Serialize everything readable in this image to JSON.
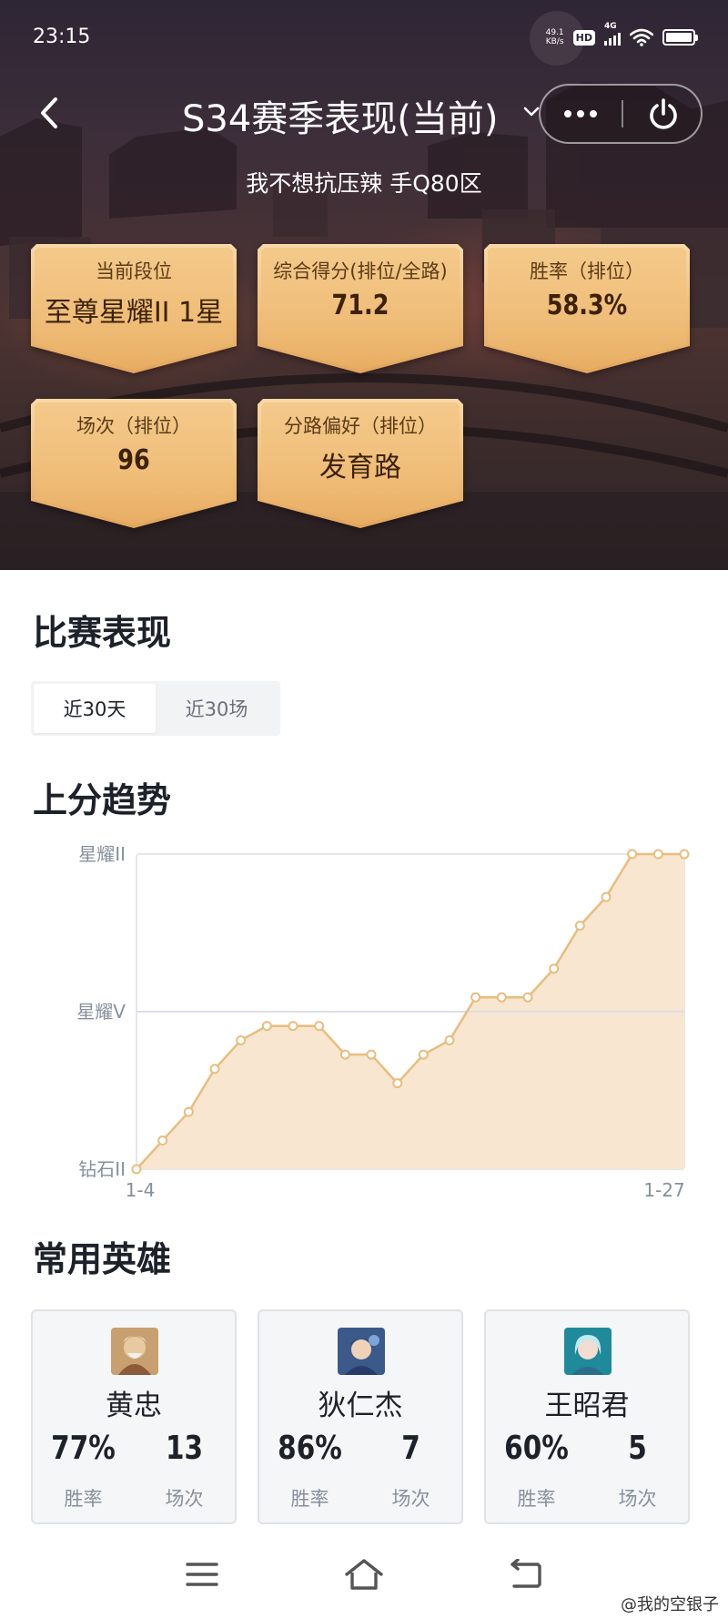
{
  "status_bar": {
    "time": "23:15",
    "net_speed_value": "49.1",
    "net_speed_unit": "KB/s",
    "hd": "HD",
    "network": "4G"
  },
  "header": {
    "title": "S34赛季表现(当前)",
    "player": "我不想抗压辣 手Q80区"
  },
  "stats": [
    {
      "label": "当前段位",
      "value": "至尊星耀II 1星"
    },
    {
      "label": "综合得分(排位/全路)",
      "value": "71.2"
    },
    {
      "label": "胜率（排位）",
      "value": "58.3%"
    },
    {
      "label": "场次（排位）",
      "value": "96"
    },
    {
      "label": "分路偏好（排位）",
      "value": "发育路"
    }
  ],
  "match_section": {
    "title": "比赛表现",
    "tabs": [
      {
        "label": "近30天",
        "active": true
      },
      {
        "label": "近30场",
        "active": false
      }
    ]
  },
  "trend_section": {
    "title": "上分趋势"
  },
  "chart_data": {
    "type": "area",
    "y_tick_labels": [
      "星耀II",
      "星耀V",
      "钻石II"
    ],
    "x_tick_labels": [
      "1-4",
      "1-27"
    ],
    "y_levels": {
      "钻石II": 0,
      "星耀V": 11,
      "星耀II": 22
    },
    "ylim": [
      0,
      22
    ],
    "values": [
      0,
      2,
      4,
      7,
      9,
      10,
      10,
      10,
      8,
      8,
      6,
      8,
      9,
      12,
      12,
      12,
      14,
      17,
      19,
      22,
      22,
      22
    ],
    "grid": true,
    "colors": {
      "line": "#e8bd7e",
      "fill": "#f8e6d0",
      "point_fill": "#ffffff"
    }
  },
  "heroes_section": {
    "title": "常用英雄",
    "heroes": [
      {
        "name": "黄忠",
        "winrate": "77%",
        "winrate_label": "胜率",
        "games": "13",
        "games_label": "场次"
      },
      {
        "name": "狄仁杰",
        "winrate": "86%",
        "winrate_label": "胜率",
        "games": "7",
        "games_label": "场次"
      },
      {
        "name": "王昭君",
        "winrate": "60%",
        "winrate_label": "胜率",
        "games": "5",
        "games_label": "场次"
      }
    ]
  },
  "watermark": "@我的空银子",
  "colors": {
    "card_gold": "#efbd78",
    "card_text": "#3d2208",
    "hero_bg": "#3d2e3a"
  },
  "icons": {
    "back": "chevron-left-icon",
    "dropdown": "chevron-down-icon",
    "more": "more-dots-icon",
    "power": "power-icon",
    "menu": "menu-icon",
    "home": "home-icon",
    "return": "back-arrow-icon"
  }
}
